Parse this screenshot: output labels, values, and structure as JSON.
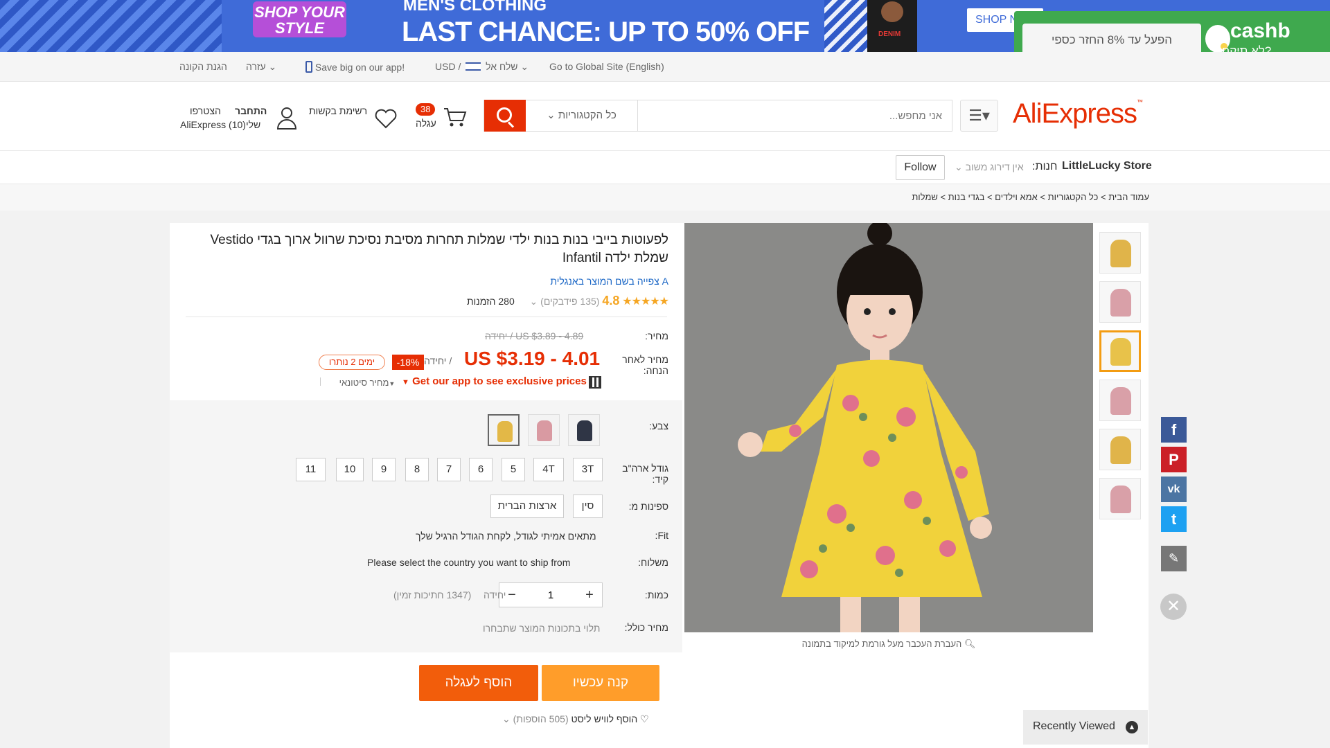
{
  "banner": {
    "shop_style": "SHOP YOUR STYLE",
    "mens": "MEN'S CLOTHING",
    "headline": "LAST CHANCE: UP TO 50% OFF",
    "shop_now": "SHOP N",
    "model_text": "DENIM"
  },
  "cashback": {
    "button": "הפעל עד 8% החזר כספי",
    "logo": "cashb",
    "subtitle": "לא תיקח?,"
  },
  "topnav": {
    "global_site": "Go to Global Site (English)",
    "ship_to": "שלח אל",
    "currency": "USD",
    "app": "Save big on our app!",
    "help": "עזרה",
    "buyer_protection": "הגנת הקונה"
  },
  "header": {
    "logo": "AliExpress",
    "search_placeholder": "אני מחפש...",
    "category": "כל הקטגוריות",
    "cart_count": "38",
    "cart_label": "עגלה",
    "wishlist_label": "רשימת בקשות",
    "signin": "התחבר",
    "join": "הצטרפו",
    "my_account": "AliExpress שלי(10)"
  },
  "store": {
    "label": "חנות:",
    "name": "LittleLucky Store",
    "rating": "אין דירוג משוב",
    "follow": "Follow"
  },
  "breadcrumb": "עמוד הבית > כל הקטגוריות > אמא וילדים > בגדי בנות > שמלות",
  "product": {
    "title": "לפעוטות בייבי בנות בנות ילדי שמלות תחרות מסיבת נסיכת שרוול ארוך בגדי Vestido שמלת ילדה Infantil",
    "translate": "צפייה בשם המוצר באנגלית",
    "stars": "★★★★★",
    "rating": "4.8",
    "feedback": "(135 פידבקים)",
    "orders": "280 הזמנות",
    "price_label": "מחיר:",
    "price_orig": "US $3.89 - 4.89 / יחידה",
    "discount_label": "מחיר לאחר הנחה:",
    "price": "US $3.19 - 4.01",
    "per_unit": "/ יחידה",
    "discount": "-18%",
    "days_left": "ימים 2 נותרו",
    "app_promo": "Get our app to see exclusive prices",
    "wholesale": "מחיר סיטונאי",
    "color_label": "צבע:",
    "size_label": "גודל ארה\"ב קיד:",
    "sizes": [
      "11",
      "10",
      "9",
      "8",
      "7",
      "6",
      "5",
      "4T",
      "3T"
    ],
    "ships_label": "ספינות מ:",
    "ship_options": [
      "ארצות הברית",
      "סין"
    ],
    "fit_label": "Fit:",
    "fit_text": "מתאים אמיתי לגודל, לקחת הגודל הרגיל שלך",
    "shipping_label": "משלוח:",
    "shipping_text": "Please select the country you want to ship from",
    "qty_label": "כמות:",
    "qty_value": "1",
    "qty_unit": "יחידה",
    "qty_available": "(1347 חתיכות זמין)",
    "total_label": "מחיר כולל:",
    "total_text": "תלוי בתכונות המוצר שתבחרו",
    "buy_now": "קנה עכשיו",
    "add_to_cart": "הוסף לעגלה",
    "wishlist": "הוסף לוויש ליסט",
    "wishlist_count": "(505 הוספות)",
    "zoom_hint": "העברת העכבר מעל גורמת למיקוד בתמונה"
  },
  "recently_viewed": "Recently Viewed",
  "social": [
    "f",
    "P",
    "vk",
    "t"
  ],
  "colors": {
    "accent": "#e62e04",
    "buy_now": "#ff9d2a",
    "add_cart": "#f25d0b",
    "cashback": "#3fa94e",
    "banner": "#3f6bd8"
  }
}
